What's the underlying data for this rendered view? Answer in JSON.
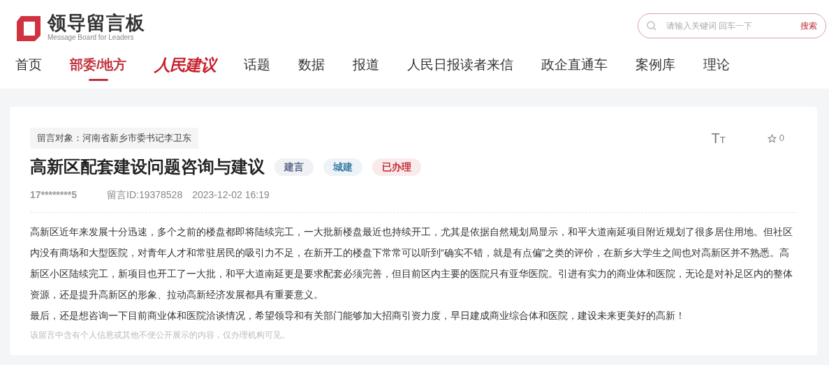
{
  "logo": {
    "title": "领导留言板",
    "subtitle": "Message Board for Leaders"
  },
  "search": {
    "placeholder": "请输入关键词 回车一下",
    "button": "搜索"
  },
  "nav": [
    {
      "label": "首页",
      "selected": false,
      "kind": "text"
    },
    {
      "label": "部委/地方",
      "selected": true,
      "kind": "text"
    },
    {
      "label": "人民建议",
      "selected": false,
      "kind": "brand"
    },
    {
      "label": "话题",
      "selected": false,
      "kind": "text"
    },
    {
      "label": "数据",
      "selected": false,
      "kind": "text"
    },
    {
      "label": "报道",
      "selected": false,
      "kind": "text"
    },
    {
      "label": "人民日报读者来信",
      "selected": false,
      "kind": "text"
    },
    {
      "label": "政企直通车",
      "selected": false,
      "kind": "text"
    },
    {
      "label": "案例库",
      "selected": false,
      "kind": "text"
    },
    {
      "label": "理论",
      "selected": false,
      "kind": "text"
    }
  ],
  "message": {
    "recipient": "留言对象：河南省新乡市委书记李卫东",
    "font_toggle": "TT",
    "favorites": "0",
    "title": "高新区配套建设问题咨询与建议",
    "tags": [
      {
        "label": "建言",
        "color": "#5b6b8c"
      },
      {
        "label": "城建",
        "color": "#3d7fa6"
      },
      {
        "label": "已办理",
        "color": "#c42a35"
      }
    ],
    "author": "17********5",
    "id": "留言ID:19378528",
    "time": "2023-12-02 16:19",
    "paragraphs": [
      "高新区近年来发展十分迅速，多个之前的楼盘都即将陆续完工，一大批新楼盘最近也持续开工，尤其是依据自然规划局显示，和平大道南延项目附近规划了很多居住用地。但社区内没有商场和大型医院，对青年人才和常驻居民的吸引力不足，在新开工的楼盘下常常可以听到“确实不错，就是有点偏”之类的评价，在新乡大学生之间也对高新区并不熟悉。高新区小区陆续完工，新项目也开工了一大批，和平大道南延更是要求配套必须完善，但目前区内主要的医院只有亚华医院。引进有实力的商业体和医院，无论是对补足区内的整体资源，还是提升高新区的形象、拉动高新经济发展都具有重要意义。",
      "最后，还是想咨询一下目前商业体和医院洽谈情况，希望领导和有关部门能够加大招商引资力度，早日建成商业综合体和医院，建设未来更美好的高新！"
    ],
    "notice": "该留言中含有个人信息或其他不便公开展示的内容，仅办理机构可见。"
  }
}
